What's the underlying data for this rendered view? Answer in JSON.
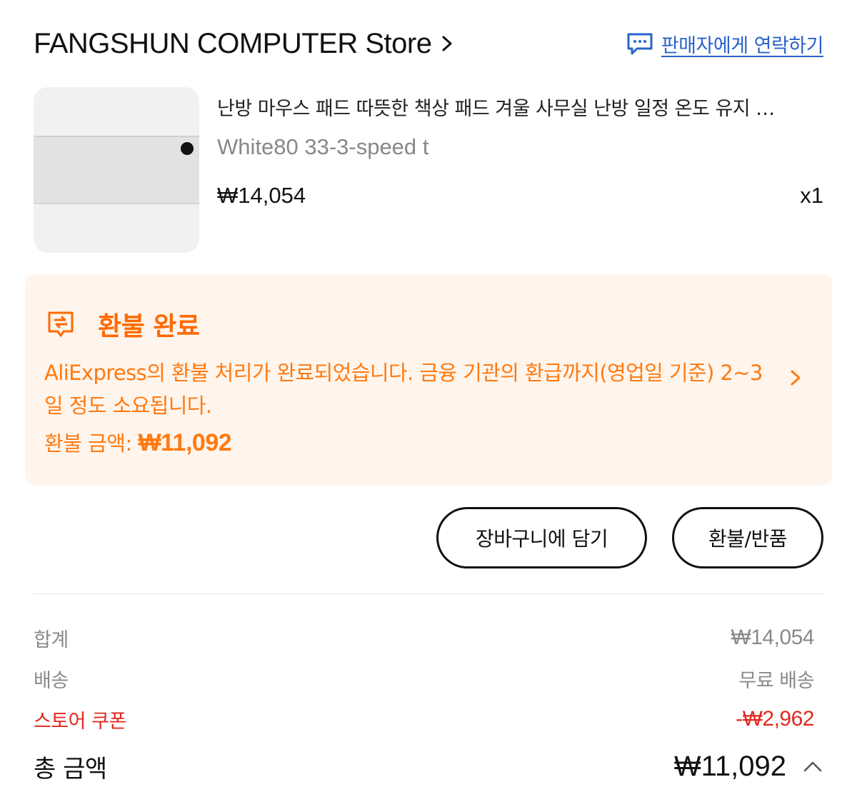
{
  "header": {
    "store_name": "FANGSHUN COMPUTER Store",
    "contact_label": "판매자에게 연락하기"
  },
  "product": {
    "title": "난방 마우스 패드 따뜻한 책상 패드 겨울 사무실 난방 일정 온도 유지 …",
    "variant": "White80 33-3-speed t",
    "price": "₩14,054",
    "quantity": "x1"
  },
  "refund_notice": {
    "title": "환불 완료",
    "message": "AliExpress의 환불 처리가 완료되었습니다. 금융 기관의 환급까지(영업일 기준) 2~3일 정도 소요됩니다.",
    "amount_label": "환불 금액: ",
    "amount_value": "₩11,092"
  },
  "actions": {
    "add_to_cart": "장바구니에 담기",
    "refund_return": "환불/반품"
  },
  "summary": {
    "subtotal_label": "합계",
    "subtotal_value": "₩14,054",
    "shipping_label": "배송",
    "shipping_value": "무료 배송",
    "coupon_label": "스토어 쿠폰",
    "coupon_value": "-₩2,962",
    "total_label": "총 금액",
    "total_value": "₩11,092"
  },
  "colors": {
    "accent_orange": "#ff6a00",
    "link_blue": "#2a63c9",
    "coupon_red": "#e0291d",
    "notice_bg": "#fff5ec"
  },
  "icons": {
    "contact": "chat-bubble-icon",
    "store_nav": "chevron-right-icon",
    "refund": "refund-receipt-icon",
    "notice_nav": "chevron-right-icon",
    "expand": "caret-up-icon"
  }
}
